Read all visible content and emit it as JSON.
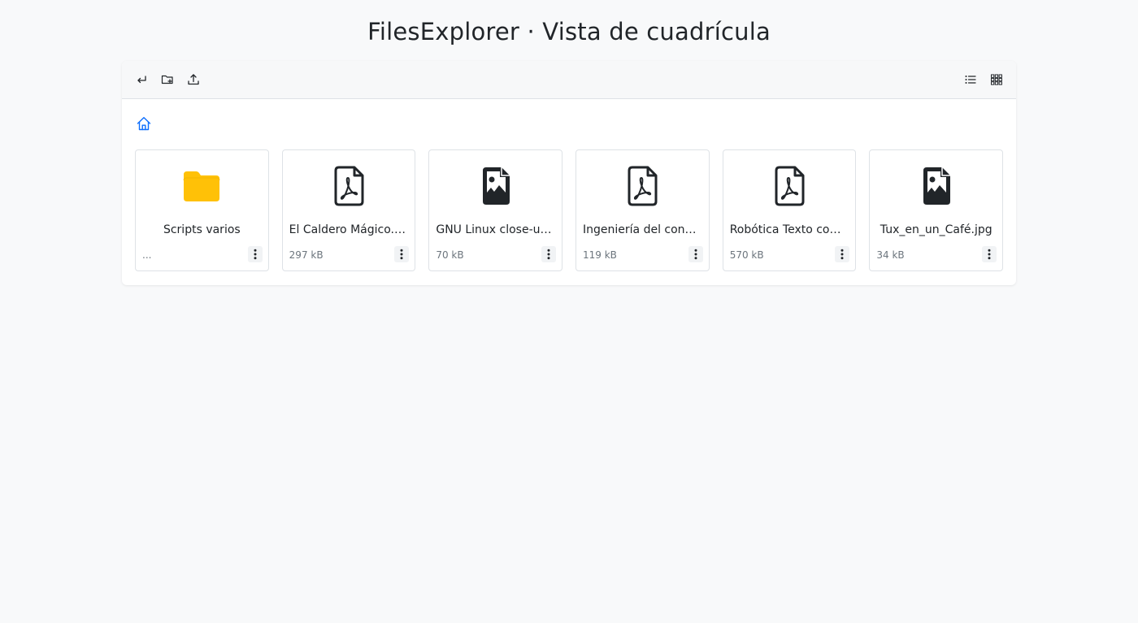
{
  "page": {
    "title": "FilesExplorer · Vista de cuadrícula"
  },
  "toolbar": {
    "left_buttons": [
      {
        "name": "back-button",
        "icon": "return-arrow-icon"
      },
      {
        "name": "new-folder-button",
        "icon": "folder-plus-icon"
      },
      {
        "name": "upload-button",
        "icon": "upload-icon"
      }
    ],
    "right_buttons": [
      {
        "name": "list-view-button",
        "icon": "list-icon"
      },
      {
        "name": "grid-view-button",
        "icon": "grid-icon"
      }
    ]
  },
  "breadcrumb": {
    "home_icon": "home-icon",
    "accent_color": "#0d6efd"
  },
  "colors": {
    "folder": "#ffc107",
    "file_icon": "#212529",
    "muted_text": "#6c757d"
  },
  "items": [
    {
      "type": "folder",
      "icon": "folder-icon",
      "name": "Scripts varios",
      "size": "..."
    },
    {
      "type": "pdf",
      "icon": "pdf-file-icon",
      "name": "El Caldero Mágico.pdf",
      "size": "297 kB"
    },
    {
      "type": "image",
      "icon": "image-file-icon",
      "name": "GNU Linux close-up.jpg",
      "size": "70 kB"
    },
    {
      "type": "pdf",
      "icon": "pdf-file-icon",
      "name": "Ingeniería del conocimiento.pdf",
      "size": "119 kB"
    },
    {
      "type": "pdf",
      "icon": "pdf-file-icon",
      "name": "Robótica Texto completo.pdf",
      "size": "570 kB"
    },
    {
      "type": "image",
      "icon": "image-file-icon",
      "name": "Tux_en_un_Café.jpg",
      "size": "34 kB"
    }
  ]
}
